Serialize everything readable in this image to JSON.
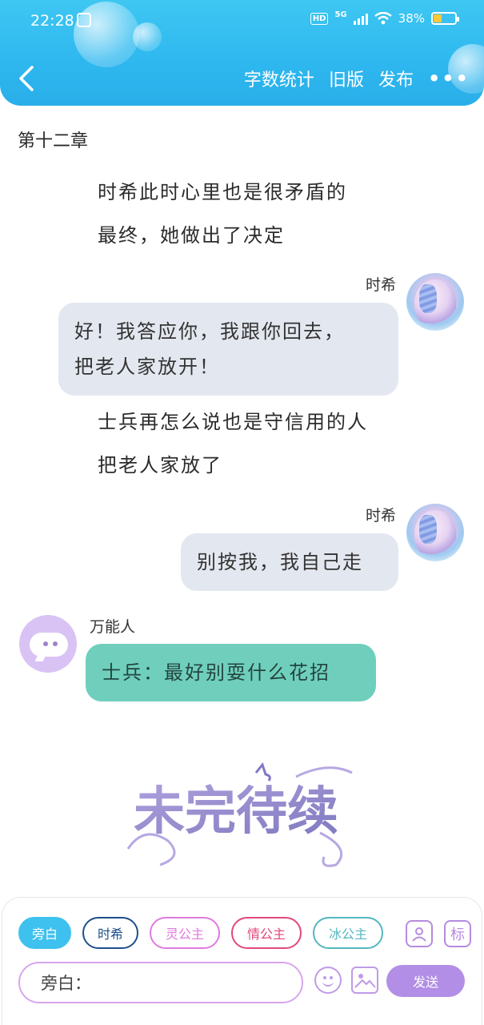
{
  "status_bar": {
    "time": "22:28",
    "hd": "HD",
    "network": "5G",
    "battery": "38%",
    "battery_level": 0.38
  },
  "nav": {
    "actions": [
      "字数统计",
      "旧版",
      "发布"
    ],
    "more": "•••"
  },
  "chapter_title": "第十二章",
  "messages": [
    {
      "type": "narration",
      "lines": [
        "时希此时心里也是很矛盾的",
        "最终，她做出了决定"
      ]
    },
    {
      "type": "right",
      "name": "时希",
      "text_lines": [
        "好！我答应你，我跟你回去，",
        "把老人家放开！"
      ]
    },
    {
      "type": "narration",
      "lines": [
        "士兵再怎么说也是守信用的人",
        "把老人家放了"
      ]
    },
    {
      "type": "right",
      "name": "时希",
      "text_lines": [
        "别按我，我自己走"
      ]
    },
    {
      "type": "left",
      "name": "万能人",
      "text_lines": [
        "士兵：最好别耍什么花招"
      ]
    }
  ],
  "footer_logo": "未完待续",
  "composer": {
    "roles": [
      {
        "label": "旁白",
        "color": "#3ec1ef",
        "active": true
      },
      {
        "label": "时希",
        "color": "#1e4f8c",
        "active": false
      },
      {
        "label": "灵公主",
        "color": "#e07adf",
        "active": false
      },
      {
        "label": "情公主",
        "color": "#e2477c",
        "active": false
      },
      {
        "label": "冰公主",
        "color": "#54b6bf",
        "active": false
      }
    ],
    "tag_icon": "标",
    "input_label": "旁白：",
    "send_label": "发送"
  }
}
